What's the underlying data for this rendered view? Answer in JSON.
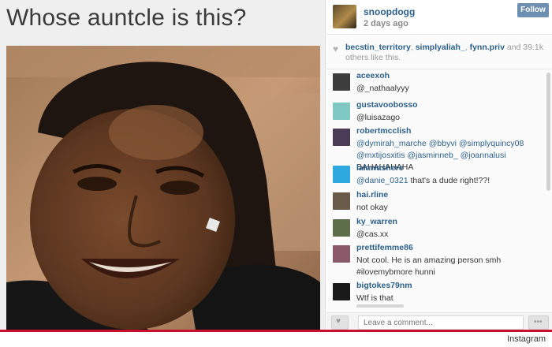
{
  "post": {
    "caption": "Whose auntcle is this?"
  },
  "header": {
    "username": "snoopdogg",
    "age": "2 days ago",
    "follow_label": "Follow"
  },
  "likes": {
    "users": [
      "becstin_territory",
      "simplyaliah_",
      "fynn.priv"
    ],
    "sep1": ", ",
    "sep2": ", ",
    "tail": " and 39.1k others like this.",
    "count": "39.1k"
  },
  "comments": [
    {
      "user": "aceexoh",
      "text": "@_nathaalyyy",
      "avatar_color": "#3d3d3d"
    },
    {
      "user": "gustavoobosso",
      "text": "@luisazago",
      "avatar_color": "#7fc7c2"
    },
    {
      "user": "robertmcclish",
      "text_parts": [
        "@dymirah_marche @bbyvi @simplyquincy08 @mxtijosxitis @jasminneb_ @joannalusi",
        " BAHAHAHAHA"
      ],
      "avatar_color": "#4a3b57"
    },
    {
      "user": "lalawashere",
      "text_parts": [
        "@danie_0321",
        " that's a dude right!??!"
      ],
      "avatar_color": "#2fa8e0"
    },
    {
      "user": "hai.rline",
      "text": "not okay",
      "avatar_color": "#6a5a4a"
    },
    {
      "user": "ky_warren",
      "text": "@cas.xx",
      "avatar_color": "#5c6e4a"
    },
    {
      "user": "prettifemme86",
      "text": "Not cool. He is an amazing person smh #ilovemybmore hunni",
      "avatar_color": "#8a5a6a"
    },
    {
      "user": "bigtokes79nm",
      "text": "Wtf is that",
      "avatar_color": "#1a1a1a"
    }
  ],
  "footer": {
    "comment_placeholder": "Leave a comment..."
  },
  "source_label": "Instagram",
  "colors": {
    "link": "#2b5f8a",
    "follow": "#6d8fb0",
    "ribbon": "#c8102e"
  },
  "icons": [
    "heart-icon",
    "more-icon"
  ]
}
